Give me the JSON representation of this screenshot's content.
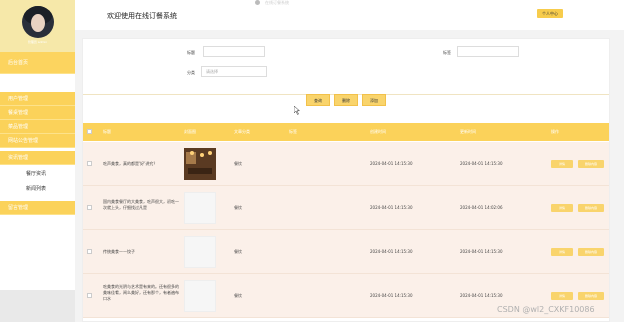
{
  "sidebar": {
    "user_name": "管理员 admin",
    "home": "后台首页",
    "items": [
      {
        "label": "用户管理"
      },
      {
        "label": "餐桌管理"
      },
      {
        "label": "菜品管理"
      },
      {
        "label": "网站公告管理"
      },
      {
        "label": "资讯管理"
      }
    ],
    "subitems": [
      {
        "label": "餐厅资讯"
      },
      {
        "label": "新闻列表"
      }
    ],
    "last_item": "留言管理"
  },
  "topbar": {
    "title": "欢迎使用在线订餐系统",
    "faint_text": "在线订餐系统",
    "user_center": "个人中心"
  },
  "filters": {
    "title_label": "标题",
    "title_value": "",
    "tag_label": "标签",
    "tag_value": "",
    "category_label": "分类",
    "category_placeholder": "请选择"
  },
  "buttons": {
    "search": "查询",
    "delete": "删除",
    "add": "添加"
  },
  "table": {
    "headers": [
      "标题",
      "封面图",
      "文章分类",
      "标签",
      "创建时间",
      "更新时间",
      "操作"
    ],
    "rows": [
      {
        "title": "吃声美食，真的都是'好'讲究？",
        "category": "餐饮",
        "tag": "",
        "created": "2024-04-01 14:15:30",
        "updated": "2024-04-01 14:15:30",
        "has_photo": true
      },
      {
        "title": "国内美食餐厅的大美食，吃声很大，初吃一次就上头，仔细找过凡是",
        "category": "餐饮",
        "tag": "",
        "created": "2024-04-01 14:15:30",
        "updated": "2024-04-01 14:02:06",
        "has_photo": false
      },
      {
        "title": "传统美食——饺子",
        "category": "餐饮",
        "tag": "",
        "created": "2024-04-01 14:15:30",
        "updated": "2024-04-01 14:15:30",
        "has_photo": false
      },
      {
        "title": "吃美食的光阴与艺术是有来的。还有很多的美味佳肴，闻么美好，还有那个，有者遍布口水",
        "category": "餐饮",
        "tag": "",
        "created": "2024-04-01 14:15:30",
        "updated": "2024-04-01 14:15:30",
        "has_photo": false
      }
    ],
    "edit_label": "详情",
    "delete_label": "删除内容"
  },
  "watermark": "CSDN @wl2_CXKF10086",
  "colors": {
    "accent": "#fbd25a",
    "row_bg": "#fbf0e9",
    "button": "#f9d46c"
  }
}
